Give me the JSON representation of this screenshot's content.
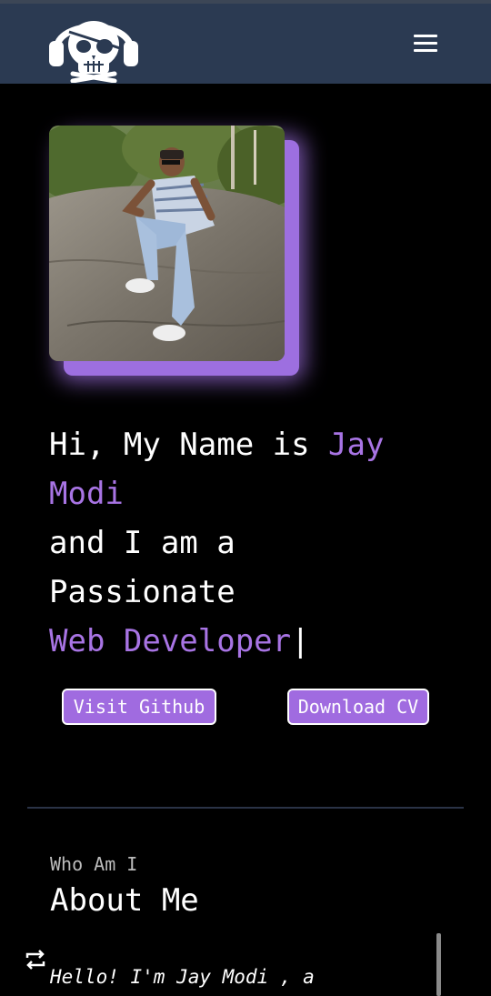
{
  "header": {
    "logo_icon": "pirate-skull-headphones-icon",
    "menu_icon": "hamburger-menu-icon"
  },
  "hero": {
    "photo_alt": "Portrait photo",
    "line1_prefix": "Hi, My Name is ",
    "name": "Jay Modi",
    "line2": "and I am a",
    "line3": "Passionate",
    "role": "Web Developer",
    "cursor": "|",
    "buttons": {
      "github": "Visit Github",
      "cv": "Download CV"
    }
  },
  "about": {
    "eyebrow": "Who Am I",
    "title": "About Me",
    "intro_text": "Hello! I'm Jay Modi , a"
  },
  "colors": {
    "accent": "#a874e4",
    "navbar": "#2b3a52",
    "background": "#000000"
  }
}
